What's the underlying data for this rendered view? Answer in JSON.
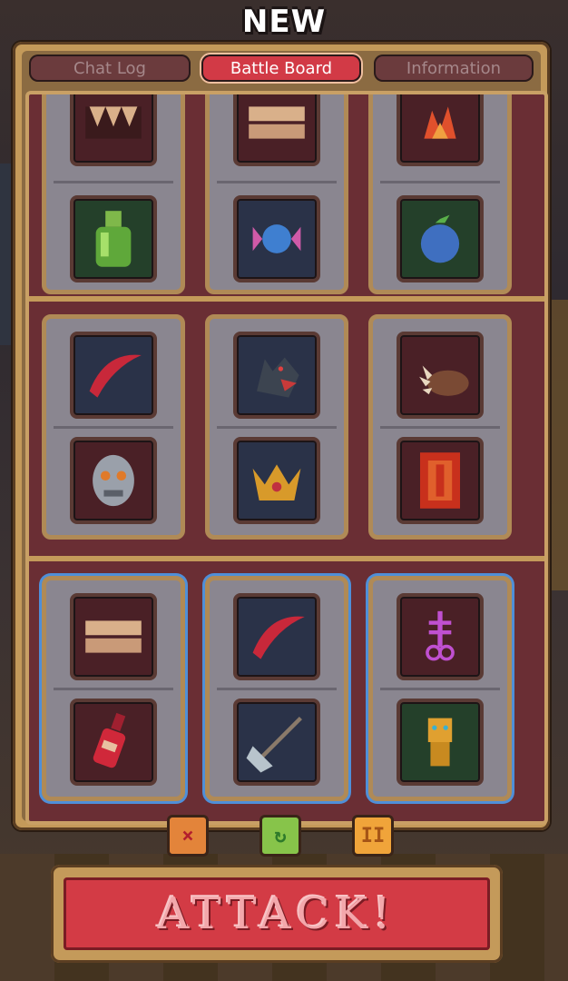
{
  "header": {
    "title": "NEW"
  },
  "tabs": [
    {
      "label": "Chat Log",
      "active": false
    },
    {
      "label": "Battle Board",
      "active": true
    },
    {
      "label": "Information",
      "active": false
    }
  ],
  "board": {
    "rows": [
      {
        "groups": [
          {
            "highlighted": false,
            "items": [
              "fangs-icon",
              "green-bottle-icon"
            ]
          },
          {
            "highlighted": false,
            "items": [
              "teeth-icon",
              "candy-icon"
            ]
          },
          {
            "highlighted": false,
            "items": [
              "fire-burst-icon",
              "blue-fruit-icon"
            ]
          }
        ]
      },
      {
        "groups": [
          {
            "highlighted": false,
            "items": [
              "red-slash-icon",
              "skull-mask-icon"
            ]
          },
          {
            "highlighted": false,
            "items": [
              "wolf-head-icon",
              "golden-crown-icon"
            ]
          },
          {
            "highlighted": false,
            "items": [
              "claw-icon",
              "red-banner-icon"
            ]
          }
        ]
      },
      {
        "groups": [
          {
            "highlighted": true,
            "items": [
              "teeth-icon",
              "red-bottle-icon"
            ]
          },
          {
            "highlighted": true,
            "items": [
              "red-slash-icon",
              "spear-icon"
            ]
          },
          {
            "highlighted": true,
            "items": [
              "leviathan-cross-icon",
              "golden-idol-icon"
            ]
          }
        ]
      }
    ]
  },
  "controls": {
    "discard": "×",
    "reroll": "↻",
    "pause": "II"
  },
  "attack_button": {
    "label": "ATTACK!"
  },
  "colors": {
    "frame": "#c49a5a",
    "board": "#6a2e34",
    "tab_active": "#d23a46",
    "tab_inactive": "#6b3b3d",
    "highlight": "#4f8fd8",
    "attack": "#d33b45"
  }
}
